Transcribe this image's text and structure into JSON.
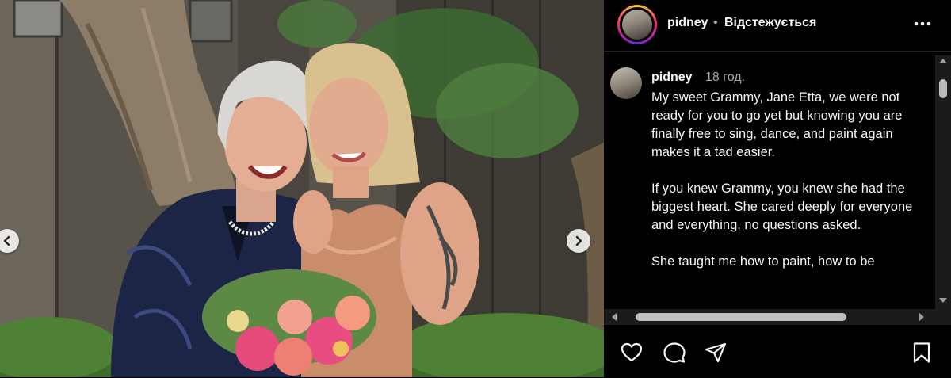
{
  "post": {
    "username": "pidney",
    "follow_status": "Відстежується",
    "separator": "•"
  },
  "caption": {
    "username": "pidney",
    "time": "18 год.",
    "text": "My sweet Grammy, Jane Etta, we were not ready for you to go yet but knowing you are finally free to sing, dance, and paint again makes it a tad easier.\n\nIf you knew Grammy, you knew she had the biggest heart. She cared deeply for everyone and everything, no questions asked.\n\nShe taught me how to paint, how to be"
  },
  "icons": {
    "more": "more-options-icon",
    "prev": "chevron-left-icon",
    "next": "chevron-right-icon",
    "like": "heart-icon",
    "comment": "comment-icon",
    "share": "share-icon",
    "save": "bookmark-icon"
  },
  "colors": {
    "background": "#000000",
    "text": "#f5f5f5",
    "secondary_text": "#a8a8a8"
  }
}
